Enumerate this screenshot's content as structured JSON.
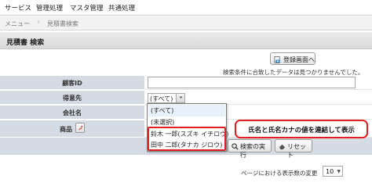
{
  "menubar": {
    "items": [
      "サービス",
      "管理処理",
      "マスタ管理",
      "共通処理"
    ]
  },
  "breadcrumb": {
    "root": "メニュー",
    "current": "見積書検索"
  },
  "section": {
    "title": "見積書 検索"
  },
  "toolbar": {
    "register_label": "登録画面へ"
  },
  "notice": "検索条件に合致したデータは見つかりませんでした。",
  "form": {
    "customer_id_label": "顧客ID",
    "customer_id_value": "",
    "client_label": "得意先",
    "client_selected": "(すべて)",
    "company_label": "会社名",
    "product_label": "商品"
  },
  "dropdown": {
    "options": [
      "(すべて)",
      "(未選択)",
      "鈴木 一郎(スズキ イチロウ)",
      "田中 二郎(タナカ ジロウ)"
    ]
  },
  "callout": {
    "text": "氏名と氏名カナの値を連結して表示"
  },
  "actions": {
    "search_label": "検索の実行",
    "reset_label": "リセット"
  },
  "footer": {
    "page_size_label": "ページにおける表示数の変更",
    "page_size_value": "10"
  },
  "colors": {
    "label_band": "#d4dbe3",
    "highlight_red": "#e12020",
    "header_gray": "#e2e2e2"
  },
  "icons": {
    "register": "document-plus-icon",
    "search": "magnifier-icon",
    "reset": "eraser-icon",
    "product_picker": "picker-icon"
  }
}
